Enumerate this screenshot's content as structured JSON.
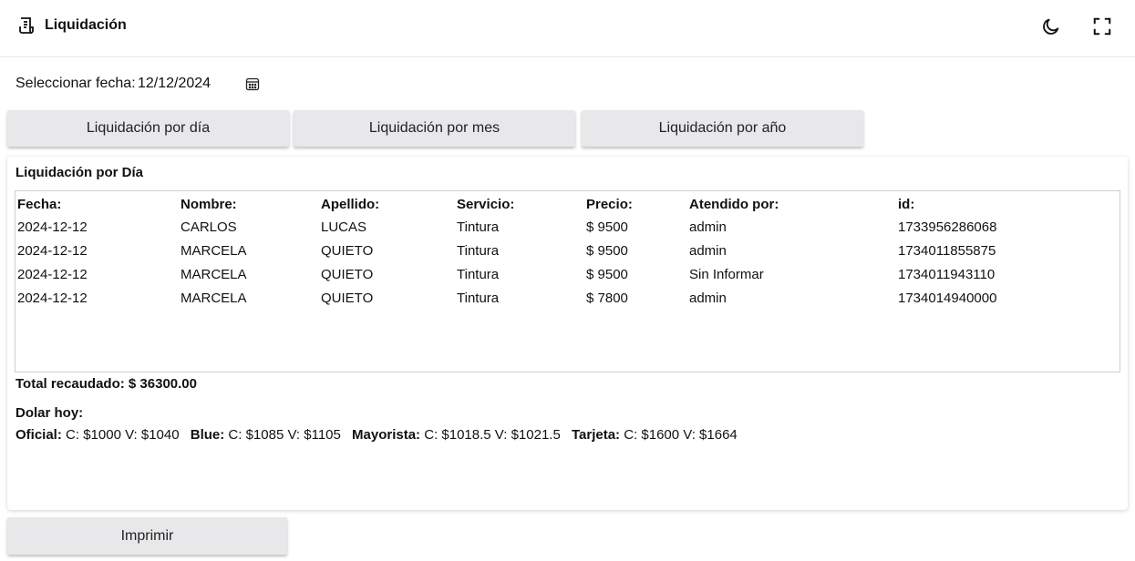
{
  "header": {
    "title": "Liquidación",
    "app_icon": "receipt-icon",
    "theme_icon": "moon-icon",
    "fullscreen_icon": "fullscreen-icon"
  },
  "date_picker": {
    "label": "Seleccionar fecha:",
    "value": "12/12/2024",
    "icon": "calendar-icon"
  },
  "tabs": [
    {
      "label": "Liquidación por día"
    },
    {
      "label": "Liquidación por mes"
    },
    {
      "label": "Liquidación por año"
    }
  ],
  "report": {
    "title": "Liquidación por Día",
    "columns": [
      "Fecha:",
      "Nombre:",
      "Apellido:",
      "Servicio:",
      "Precio:",
      "Atendido por:",
      "id:"
    ],
    "rows": [
      [
        "2024-12-12",
        "CARLOS",
        "LUCAS",
        "Tintura",
        "$ 9500",
        "admin",
        "1733956286068"
      ],
      [
        "2024-12-12",
        "MARCELA",
        "QUIETO",
        "Tintura",
        "$ 9500",
        "admin",
        "1734011855875"
      ],
      [
        "2024-12-12",
        "MARCELA",
        "QUIETO",
        "Tintura",
        "$ 9500",
        "Sin Informar",
        "1734011943110"
      ],
      [
        "2024-12-12",
        "MARCELA",
        "QUIETO",
        "Tintura",
        "$ 7800",
        "admin",
        "1734014940000"
      ]
    ],
    "total": "Total recaudado: $ 36300.00",
    "dolar_title": "Dolar hoy:",
    "dolar": [
      {
        "name": "Oficial:",
        "value": "C: $1000 V: $1040"
      },
      {
        "name": "Blue:",
        "value": "C: $1085 V: $1105"
      },
      {
        "name": "Mayorista:",
        "value": "C: $1018.5 V: $1021.5"
      },
      {
        "name": "Tarjeta:",
        "value": "C: $1600 V: $1664"
      }
    ]
  },
  "print_button": {
    "label": "Imprimir"
  }
}
